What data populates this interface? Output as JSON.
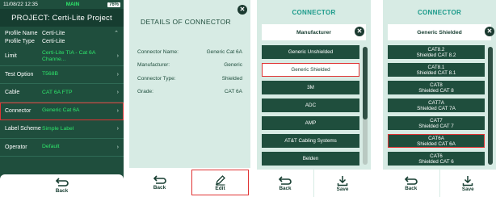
{
  "screen1": {
    "status": {
      "datetime": "11/08/22 12:35",
      "mode": "MAIN",
      "battery": "76%"
    },
    "title": "PROJECT: Certi-Lite Project",
    "profile_name_label": "Profile Name",
    "profile_name_value": "Certi-Lite",
    "profile_type_label": "Profile Type",
    "profile_type_value": "Certi-Lite",
    "rows": [
      {
        "label": "Limit",
        "value": "Certi-Lite TIA - Cat 6A Channe..."
      },
      {
        "label": "Test Option",
        "value": "T568B"
      },
      {
        "label": "Cable",
        "value": "CAT 6A FTP"
      },
      {
        "label": "Connector",
        "value": "Generic Cat 6A"
      },
      {
        "label": "Label Scheme",
        "value": "Simple Label"
      },
      {
        "label": "Operator",
        "value": "Default"
      }
    ],
    "back_label": "Back"
  },
  "screen2": {
    "title": "DETAILS OF CONNECTOR",
    "close": "✕",
    "fields": [
      {
        "label": "Connector Name:",
        "value": "Generic Cat 6A"
      },
      {
        "label": "Manufacturer:",
        "value": "Generic"
      },
      {
        "label": "Connector Type:",
        "value": "Shielded"
      },
      {
        "label": "Grade:",
        "value": "CAT 6A"
      }
    ],
    "back_label": "Back",
    "edit_label": "Edit"
  },
  "screen3": {
    "header": "CONNECTOR",
    "subheader": "Manufacturer",
    "items": [
      "Generic Unshielded",
      "Generic Shielded",
      "3M",
      "ADC",
      "AMP",
      "AT&T Cabling Systems",
      "Belden"
    ],
    "selected_index": 1,
    "back_label": "Back",
    "save_label": "Save"
  },
  "screen4": {
    "header": "CONNECTOR",
    "subheader": "Generic Shielded",
    "items": [
      {
        "l1": "CAT8.2",
        "l2": "Shielded CAT 8.2"
      },
      {
        "l1": "CAT8.1",
        "l2": "Shielded CAT 8.1"
      },
      {
        "l1": "CAT8",
        "l2": "Shielded CAT 8"
      },
      {
        "l1": "CAT7A",
        "l2": "Shielded CAT 7A"
      },
      {
        "l1": "CAT7",
        "l2": "Shielded CAT 7"
      },
      {
        "l1": "CAT6A",
        "l2": "Shielded CAT 6A"
      },
      {
        "l1": "CAT6",
        "l2": "Shielded CAT 6"
      }
    ],
    "selected_index": 5,
    "back_label": "Back",
    "save_label": "Save"
  },
  "colors": {
    "primary": "#1f4e3d",
    "accent_green": "#2ee66b",
    "highlight_red": "#e03333",
    "panel": "#d7ebe4",
    "header_teal": "#1a9a8a"
  }
}
